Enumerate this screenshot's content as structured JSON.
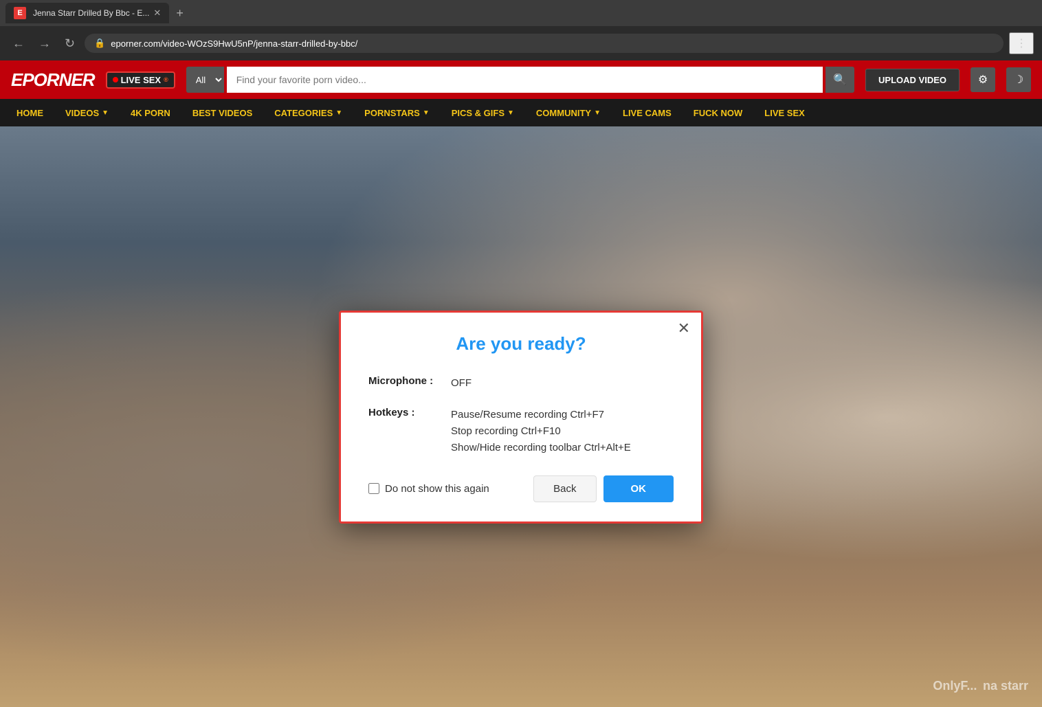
{
  "browser": {
    "tab_title": "Jenna Starr Drilled By Bbc - E...",
    "favicon_letter": "E",
    "address": "eporner.com/video-WOzS9HwU5nP/jenna-starr-drilled-by-bbc/",
    "address_prefix": "eporner.com",
    "address_full": "eporner.com/video-WOzS9HwU5nP/jenna-starr-drilled-by-bbc/"
  },
  "site": {
    "logo": "EPORNER",
    "live_sex_label": "LIVE SEX",
    "live_sex_sup": "®",
    "search_placeholder": "Find your favorite porn video...",
    "search_filter": "All",
    "upload_btn": "UPLOAD VIDEO"
  },
  "nav": {
    "items": [
      {
        "label": "HOME",
        "has_arrow": false
      },
      {
        "label": "VIDEOS",
        "has_arrow": true
      },
      {
        "label": "4K PORN",
        "has_arrow": false
      },
      {
        "label": "BEST VIDEOS",
        "has_arrow": false
      },
      {
        "label": "CATEGORIES",
        "has_arrow": true
      },
      {
        "label": "PORNSTARS",
        "has_arrow": true
      },
      {
        "label": "PICS & GIFS",
        "has_arrow": true
      },
      {
        "label": "COMMUNITY",
        "has_arrow": true
      },
      {
        "label": "LIVE CAMS",
        "has_arrow": false
      },
      {
        "label": "FUCK NOW",
        "has_arrow": false
      },
      {
        "label": "LIVE SEX",
        "has_arrow": false
      }
    ]
  },
  "modal": {
    "title": "Are you ready?",
    "microphone_label": "Microphone :",
    "microphone_value": "OFF",
    "hotkeys_label": "Hotkeys :",
    "hotkeys_lines": [
      "Pause/Resume recording Ctrl+F7",
      "Stop recording Ctrl+F10",
      "Show/Hide recording toolbar Ctrl+Alt+E"
    ],
    "checkbox_label": "Do not show this again",
    "back_btn": "Back",
    "ok_btn": "OK"
  },
  "watermark": "OnlyF... na starr"
}
